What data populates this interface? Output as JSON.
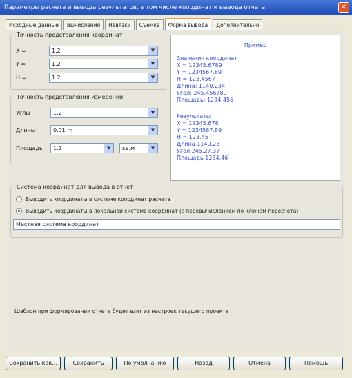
{
  "window": {
    "title": "Параметры расчета и вывода результатов, в том числе координат и вывода отчета",
    "close_glyph": "✕"
  },
  "tabs": [
    {
      "label": "Исходные данные"
    },
    {
      "label": "Вычисления"
    },
    {
      "label": "Невязки"
    },
    {
      "label": "Съемка"
    },
    {
      "label": "Форма вывода",
      "active": true
    },
    {
      "label": "Дополнительно"
    }
  ],
  "precision": {
    "legend": "Точность представления координат",
    "rows": [
      {
        "label": "X =",
        "value": "1.2"
      },
      {
        "label": "Y =",
        "value": "1.2"
      },
      {
        "label": "H =",
        "value": "1.2"
      }
    ]
  },
  "angles": {
    "legend": "Точность представления измерений",
    "rows": [
      {
        "label": "Углы",
        "value": "1.2"
      },
      {
        "label": "Длины",
        "value": "0.01 m"
      },
      {
        "label": "Площадь",
        "value": "1.2",
        "unit": "кв.м"
      }
    ]
  },
  "preview": {
    "header": "Пример",
    "block1": [
      "Значения координат",
      "X = 12345.6789",
      "Y = 1234567.89",
      "H = 123.4567",
      "Длина: 1140.234",
      "Угол: 245.456789",
      "Площадь: 1234.456"
    ],
    "block2": [
      "Результаты",
      "X = 12345.678",
      "Y = 1234567.89",
      "H = 123.45",
      "Длина 1140.23",
      "Угол 245.27.37",
      "Площадь 1234.46"
    ]
  },
  "report": {
    "legend": "Система координат для вывода в отчет",
    "options": [
      {
        "label": "Выводить координаты в системе координат расчета",
        "selected": false
      },
      {
        "label": "Выводить координаты в локальной системе координат (с перевычислением по ключам пересчета)",
        "selected": true
      }
    ],
    "field_value": "Местная система координат"
  },
  "note": "Шаблон при формировании отчета будет взят из настроек текущего проекта",
  "buttons": [
    {
      "label": "Сохранить как..."
    },
    {
      "label": "Сохранить"
    },
    {
      "label": "По умолчанию"
    },
    {
      "label": "Назад"
    },
    {
      "label": "Отмена"
    },
    {
      "label": "Помощь"
    }
  ]
}
